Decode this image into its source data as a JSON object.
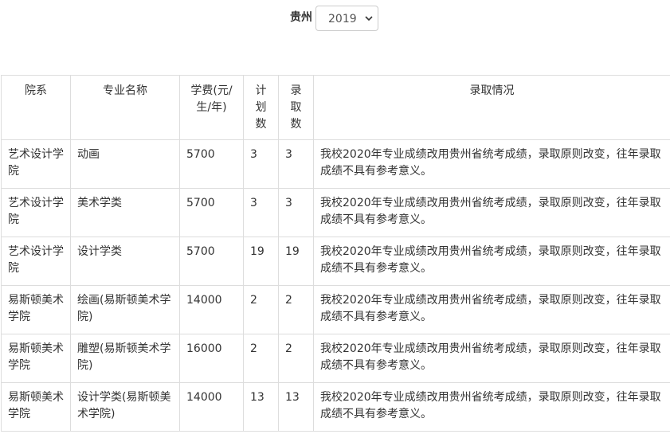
{
  "filter": {
    "province": "贵州",
    "year": "2019"
  },
  "table": {
    "headers": {
      "department": "院系",
      "major": "专业名称",
      "tuition": "学费(元/生/年)",
      "plan": "计划数",
      "admitted": "录取数",
      "status": "录取情况"
    },
    "rows": [
      {
        "department": "艺术设计学院",
        "major": "动画",
        "tuition": "5700",
        "plan": "3",
        "admitted": "3",
        "status": "我校2020年专业成绩改用贵州省统考成绩，录取原则改变，往年录取成绩不具有参考意义。"
      },
      {
        "department": "艺术设计学院",
        "major": "美术学类",
        "tuition": "5700",
        "plan": "3",
        "admitted": "3",
        "status": "我校2020年专业成绩改用贵州省统考成绩，录取原则改变，往年录取成绩不具有参考意义。"
      },
      {
        "department": "艺术设计学院",
        "major": "设计学类",
        "tuition": "5700",
        "plan": "19",
        "admitted": "19",
        "status": "我校2020年专业成绩改用贵州省统考成绩，录取原则改变，往年录取成绩不具有参考意义。"
      },
      {
        "department": "易斯顿美术学院",
        "major": "绘画(易斯顿美术学院)",
        "tuition": "14000",
        "plan": "2",
        "admitted": "2",
        "status": "我校2020年专业成绩改用贵州省统考成绩，录取原则改变，往年录取成绩不具有参考意义。"
      },
      {
        "department": "易斯顿美术学院",
        "major": "雕塑(易斯顿美术学院)",
        "tuition": "16000",
        "plan": "2",
        "admitted": "2",
        "status": "我校2020年专业成绩改用贵州省统考成绩，录取原则改变，往年录取成绩不具有参考意义。"
      },
      {
        "department": "易斯顿美术学院",
        "major": "设计学类(易斯顿美术学院)",
        "tuition": "14000",
        "plan": "13",
        "admitted": "13",
        "status": "我校2020年专业成绩改用贵州省统考成绩，录取原则改变，往年录取成绩不具有参考意义。"
      }
    ]
  }
}
